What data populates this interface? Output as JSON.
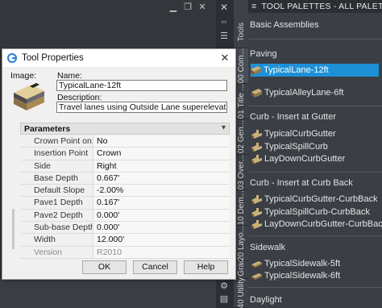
{
  "background": {
    "window_buttons": [
      "▁",
      "❐",
      "✕"
    ]
  },
  "sidebar": {
    "tabs": [
      "Tools",
      "00 Com...",
      "01 Title ...",
      "02 Gen...",
      "03 Over...",
      "10 Dem...",
      "20 Layo...",
      "30 Grad...",
      "40 Utility"
    ]
  },
  "palette": {
    "title": "TOOL PALETTES - ALL PALETTES",
    "sections": [
      {
        "label": "Basic Assemblies",
        "tools": []
      },
      {
        "label": "Paving",
        "tools": [
          {
            "label": "TypicalLane-12ft",
            "selected": true
          },
          {
            "label": "TypicalAlleyLane-6ft",
            "selected": false
          }
        ]
      },
      {
        "label": "Curb - Insert at Gutter",
        "tools": [
          {
            "label": "TypicalCurbGutter",
            "selected": false
          },
          {
            "label": "TypicalSpillCurb",
            "selected": false
          },
          {
            "label": "LayDownCurbGutter",
            "selected": false
          }
        ]
      },
      {
        "label": "Curb - Insert at Curb Back",
        "tools": [
          {
            "label": "TypicalCurbGutter-CurbBack",
            "selected": false
          },
          {
            "label": "TypicalSpillCurb-CurbBack",
            "selected": false
          },
          {
            "label": "LayDownCurbGutter-CurbBack",
            "selected": false
          }
        ]
      },
      {
        "label": "Sidewalk",
        "tools": [
          {
            "label": "TypicalSidewalk-5ft",
            "selected": false
          },
          {
            "label": "TypicalSidewalk-6ft",
            "selected": false
          }
        ]
      },
      {
        "label": "Daylight",
        "tools": []
      }
    ]
  },
  "dialog": {
    "title": "Tool Properties",
    "image_label": "Image:",
    "name_label": "Name:",
    "name_value": "TypicalLane-12ft",
    "description_label": "Description:",
    "description_value": "Travel lanes using Outside Lane superelevation slope.",
    "parameters_title": "Parameters",
    "parameters": [
      {
        "name": "Crown Point on...",
        "value": "No",
        "readonly": false
      },
      {
        "name": "Insertion Point",
        "value": "Crown",
        "readonly": false
      },
      {
        "name": "Side",
        "value": "Right",
        "readonly": false
      },
      {
        "name": "Base Depth",
        "value": "0.667'",
        "readonly": false
      },
      {
        "name": "Default Slope",
        "value": "-2.00%",
        "readonly": false
      },
      {
        "name": "Pave1 Depth",
        "value": "0.167'",
        "readonly": false
      },
      {
        "name": "Pave2 Depth",
        "value": "0.000'",
        "readonly": false
      },
      {
        "name": "Sub-base Depth",
        "value": "0.000'",
        "readonly": false
      },
      {
        "name": "Width",
        "value": "12.000'",
        "readonly": false
      },
      {
        "name": "Version",
        "value": "R2010",
        "readonly": true
      }
    ],
    "buttons": {
      "ok": "OK",
      "cancel": "Cancel",
      "help": "Help"
    }
  },
  "colors": {
    "selection": "#1e90d6",
    "palette_bg": "#3b3f45",
    "dialog_bg": "#f0f0f0"
  }
}
